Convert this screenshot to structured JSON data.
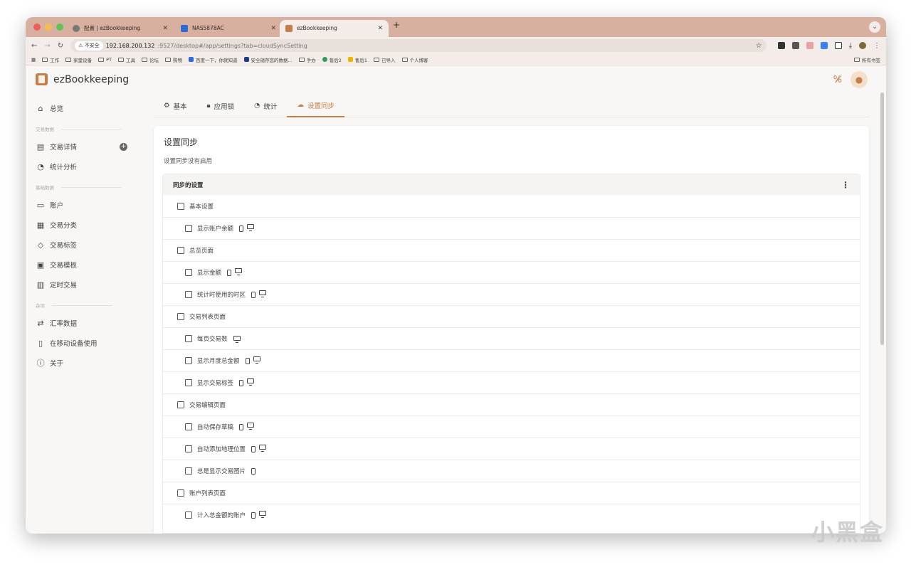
{
  "browser": {
    "tabs": [
      {
        "title": "配置 | ezBookkeeping",
        "active": false
      },
      {
        "title": "NAS5878AC",
        "active": false
      },
      {
        "title": "ezBookkeeping",
        "active": true
      }
    ],
    "url": {
      "security_label": "不安全",
      "host": "192.168.200.132",
      "path": ":9527/desktop#/app/settings?tab=cloudSyncSetting"
    },
    "bookmarks": [
      "工作",
      "家里设备",
      "PT",
      "工具",
      "论坛",
      "购物",
      "百度一下，你就知道",
      "安全储存您的数据...",
      "手办",
      "售后2",
      "售后1",
      "已导入",
      "个人博客"
    ],
    "all_bookmarks": "所有书签"
  },
  "app": {
    "name": "ezBookkeeping"
  },
  "sidebar": {
    "overview": "总览",
    "sections": {
      "transaction_data": "交易数据",
      "basic_data": "基础数据",
      "misc": "杂项"
    },
    "items": {
      "transaction_details": "交易详情",
      "statistics": "统计分析",
      "accounts": "账户",
      "categories": "交易分类",
      "tags": "交易标签",
      "templates": "交易模板",
      "scheduled": "定时交易",
      "exchange_rates": "汇率数据",
      "mobile": "在移动设备使用",
      "about": "关于"
    }
  },
  "settings_tabs": [
    "基本",
    "应用锁",
    "统计",
    "设置同步"
  ],
  "card": {
    "title": "设置同步",
    "subtitle": "设置同步没有启用",
    "list_header": "同步的设置",
    "rows": [
      {
        "label": "基本设置",
        "level": 0,
        "devices": []
      },
      {
        "label": "显示账户余额",
        "level": 1,
        "devices": [
          "phone",
          "monitor"
        ]
      },
      {
        "label": "总览页面",
        "level": 0,
        "devices": []
      },
      {
        "label": "显示金额",
        "level": 1,
        "devices": [
          "phone",
          "monitor"
        ]
      },
      {
        "label": "统计时使用的时区",
        "level": 1,
        "devices": [
          "phone",
          "monitor"
        ]
      },
      {
        "label": "交易列表页面",
        "level": 0,
        "devices": []
      },
      {
        "label": "每页交易数",
        "level": 1,
        "devices": [
          "monitor"
        ]
      },
      {
        "label": "显示月度总金额",
        "level": 1,
        "devices": [
          "phone",
          "monitor"
        ]
      },
      {
        "label": "显示交易标签",
        "level": 1,
        "devices": [
          "phone",
          "monitor"
        ]
      },
      {
        "label": "交易编辑页面",
        "level": 0,
        "devices": []
      },
      {
        "label": "自动保存草稿",
        "level": 1,
        "devices": [
          "phone",
          "monitor"
        ]
      },
      {
        "label": "自动添加地理位置",
        "level": 1,
        "devices": [
          "phone",
          "monitor"
        ]
      },
      {
        "label": "总是显示交易图片",
        "level": 1,
        "devices": [
          "phone"
        ]
      },
      {
        "label": "账户列表页面",
        "level": 0,
        "devices": []
      },
      {
        "label": "计入总金额的账户",
        "level": 1,
        "devices": [
          "phone",
          "monitor"
        ]
      }
    ]
  },
  "watermark": "小黑盒",
  "colors": {
    "accent": "#c67e48",
    "tabstrip": "#d8b0a0"
  }
}
